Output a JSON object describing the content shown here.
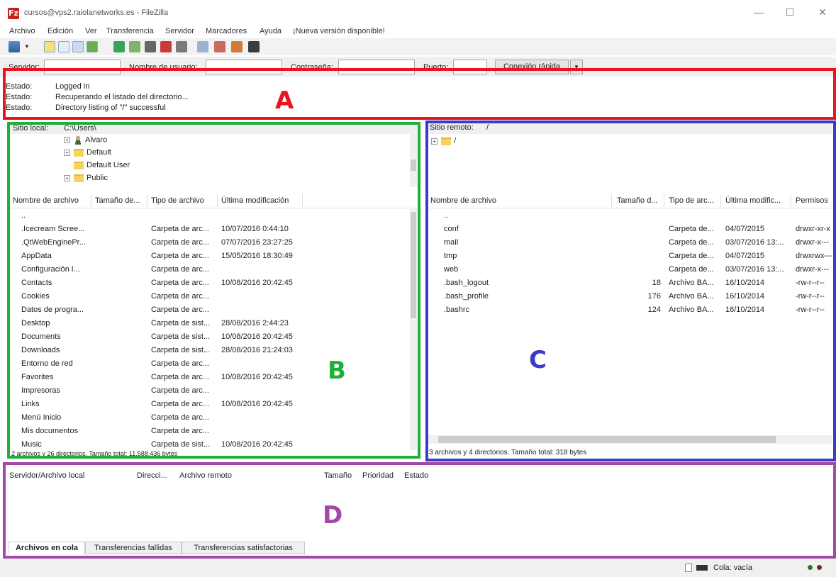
{
  "window": {
    "title": "cursos@vps2.raiolanetworks.es - FileZilla",
    "app_icon_glyph": "Fz",
    "minimize": "—",
    "maximize": "☐",
    "close": "✕"
  },
  "menu": [
    "Archivo",
    "Edición",
    "Ver",
    "Transferencia",
    "Servidor",
    "Marcadores",
    "Ayuda",
    "¡Nueva versión disponible!"
  ],
  "toolbar_icons": [
    "site-manager-icon",
    "dropdown-arrow-icon",
    "toggle-message-log-icon",
    "toggle-local-tree-icon",
    "toggle-remote-tree-icon",
    "toggle-transfer-queue-icon",
    "refresh-icon",
    "process-queue-icon",
    "cancel-icon",
    "disconnect-icon",
    "reconnect-icon",
    "directory-filter-icon",
    "compare-icon",
    "sync-browse-icon",
    "search-icon"
  ],
  "quickconnect": {
    "host_label": "Servidor:",
    "user_label": "Nombre de usuario:",
    "pass_label": "Contraseña:",
    "port_label": "Puerto:",
    "button": "Conexión rápida",
    "dropdown": "▼"
  },
  "log": [
    {
      "key": "Estado:",
      "msg": "Logged in"
    },
    {
      "key": "Estado:",
      "msg": "Recuperando el listado del directorio..."
    },
    {
      "key": "Estado:",
      "msg": "Directory listing of \"/\" successful"
    }
  ],
  "regions": {
    "a": {
      "label": "A",
      "color": "#e8141f"
    },
    "b": {
      "label": "B",
      "color": "#1fb03a"
    },
    "c": {
      "label": "C",
      "color": "#3b3bc8"
    },
    "d": {
      "label": "D",
      "color": "#a34aa8"
    }
  },
  "local": {
    "site_label": "Sitio local:",
    "site_value": "C:\\Users\\",
    "tree": [
      {
        "label": "Alvaro",
        "icon": "user-icon",
        "expander": "+"
      },
      {
        "label": "Default",
        "icon": "folder-icon",
        "expander": "+"
      },
      {
        "label": "Default User",
        "icon": "folder-icon",
        "expander": ""
      },
      {
        "label": "Public",
        "icon": "folder-icon",
        "expander": "+"
      }
    ],
    "columns": [
      "Nombre de archivo",
      "Tamaño de...",
      "Tipo de archivo",
      "Última modificación"
    ],
    "files": [
      {
        "name": "..",
        "type": "",
        "modified": ""
      },
      {
        "name": ".Icecream Scree...",
        "type": "Carpeta de arc...",
        "modified": "10/07/2016 0:44:10"
      },
      {
        "name": ".QtWebEnginePr...",
        "type": "Carpeta de arc...",
        "modified": "07/07/2016 23:27:25"
      },
      {
        "name": "AppData",
        "type": "Carpeta de arc...",
        "modified": "15/05/2016 18:30:49"
      },
      {
        "name": "Configuración l...",
        "type": "Carpeta de arc...",
        "modified": ""
      },
      {
        "name": "Contacts",
        "type": "Carpeta de arc...",
        "modified": "10/08/2016 20:42:45"
      },
      {
        "name": "Cookies",
        "type": "Carpeta de arc...",
        "modified": ""
      },
      {
        "name": "Datos de progra...",
        "type": "Carpeta de arc...",
        "modified": ""
      },
      {
        "name": "Desktop",
        "type": "Carpeta de sist...",
        "modified": "28/08/2016 2:44:23"
      },
      {
        "name": "Documents",
        "type": "Carpeta de sist...",
        "modified": "10/08/2016 20:42:45"
      },
      {
        "name": "Downloads",
        "type": "Carpeta de sist...",
        "modified": "28/08/2016 21:24:03"
      },
      {
        "name": "Entorno de red",
        "type": "Carpeta de arc...",
        "modified": ""
      },
      {
        "name": "Favorites",
        "type": "Carpeta de arc...",
        "modified": "10/08/2016 20:42:45"
      },
      {
        "name": "Impresoras",
        "type": "Carpeta de arc...",
        "modified": ""
      },
      {
        "name": "Links",
        "type": "Carpeta de arc...",
        "modified": "10/08/2016 20:42:45"
      },
      {
        "name": "Menú Inicio",
        "type": "Carpeta de arc...",
        "modified": ""
      },
      {
        "name": "Mis documentos",
        "type": "Carpeta de arc...",
        "modified": ""
      },
      {
        "name": "Music",
        "type": "Carpeta de sist...",
        "modified": "10/08/2016 20:42:45"
      }
    ],
    "summary": "2 archivos y 26 directorios. Tamaño total: 11.588.436 bytes"
  },
  "remote": {
    "site_label": "Sitio remoto:",
    "site_value": "/",
    "tree": [
      {
        "label": "/",
        "expander": "+"
      }
    ],
    "columns": [
      "Nombre de archivo",
      "Tamaño d...",
      "Tipo de arc...",
      "Última modific...",
      "Permisos"
    ],
    "files": [
      {
        "name": "..",
        "size": "",
        "type": "",
        "modified": "",
        "perms": "",
        "kind": "folder"
      },
      {
        "name": "conf",
        "size": "",
        "type": "Carpeta de...",
        "modified": "04/07/2015",
        "perms": "drwxr-xr-x",
        "kind": "folder"
      },
      {
        "name": "mail",
        "size": "",
        "type": "Carpeta de...",
        "modified": "03/07/2016 13:...",
        "perms": "drwxr-x---",
        "kind": "folder"
      },
      {
        "name": "tmp",
        "size": "",
        "type": "Carpeta de...",
        "modified": "04/07/2015",
        "perms": "drwxrwx---",
        "kind": "folder"
      },
      {
        "name": "web",
        "size": "",
        "type": "Carpeta de...",
        "modified": "03/07/2016 13:...",
        "perms": "drwxr-x---",
        "kind": "folder"
      },
      {
        "name": ".bash_logout",
        "size": "18",
        "type": "Archivo BA...",
        "modified": "16/10/2014",
        "perms": "-rw-r--r--",
        "kind": "file"
      },
      {
        "name": ".bash_profile",
        "size": "176",
        "type": "Archivo BA...",
        "modified": "16/10/2014",
        "perms": "-rw-r--r--",
        "kind": "file"
      },
      {
        "name": ".bashrc",
        "size": "124",
        "type": "Archivo BA...",
        "modified": "16/10/2014",
        "perms": "-rw-r--r--",
        "kind": "file"
      }
    ],
    "summary": "3 archivos y 4 directorios. Tamaño total: 318 bytes"
  },
  "queue": {
    "columns": [
      "Servidor/Archivo local",
      "Direcci...",
      "Archivo remoto",
      "Tamaño",
      "Prioridad",
      "Estado"
    ],
    "tabs": [
      "Archivos en cola",
      "Transferencias fallidas",
      "Transferencias satisfactorias"
    ]
  },
  "statusbar": {
    "queue": "Cola: vacía"
  }
}
